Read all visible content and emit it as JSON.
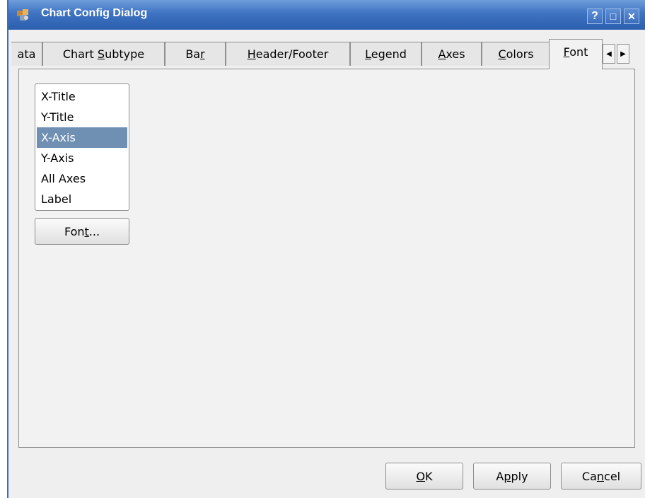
{
  "window": {
    "title": "Chart Config Dialog",
    "help_glyph": "?",
    "maximize_glyph": "□",
    "close_glyph": "✕"
  },
  "tabs": [
    {
      "label": "ata",
      "pre": "ata",
      "mn": "",
      "post": ""
    },
    {
      "label": "Chart Subtype",
      "pre": "Chart ",
      "mn": "S",
      "post": "ubtype"
    },
    {
      "label": "Bar",
      "pre": "Ba",
      "mn": "r",
      "post": ""
    },
    {
      "label": "Header/Footer",
      "pre": "",
      "mn": "H",
      "post": "eader/Footer"
    },
    {
      "label": "Legend",
      "pre": "",
      "mn": "L",
      "post": "egend"
    },
    {
      "label": "Axes",
      "pre": "",
      "mn": "A",
      "post": "xes"
    },
    {
      "label": "Colors",
      "pre": "",
      "mn": "C",
      "post": "olors"
    },
    {
      "label": "Font",
      "pre": "",
      "mn": "F",
      "post": "ont",
      "active": true
    }
  ],
  "tab_scroll": {
    "left_glyph": "◀",
    "right_glyph": "▶"
  },
  "font_list": {
    "items": [
      "X-Title",
      "Y-Title",
      "X-Axis",
      "Y-Axis",
      "All Axes",
      "Label"
    ],
    "selected": "X-Axis"
  },
  "font_button": {
    "pre": "Fon",
    "mn": "t",
    "post": "..."
  },
  "buttons": {
    "ok": {
      "pre": "",
      "mn": "O",
      "post": "K"
    },
    "apply": {
      "pre": "A",
      "mn": "p",
      "post": "ply"
    },
    "cancel": {
      "pre": "Ca",
      "mn": "n",
      "post": "cel"
    }
  },
  "colors": {
    "titlebar": "#3e73c2",
    "selection": "#6f8fb3",
    "panel": "#efefef"
  },
  "icons": [
    "app-icon",
    "help-icon",
    "maximize-icon",
    "close-icon",
    "scroll-left-icon",
    "scroll-right-icon"
  ]
}
